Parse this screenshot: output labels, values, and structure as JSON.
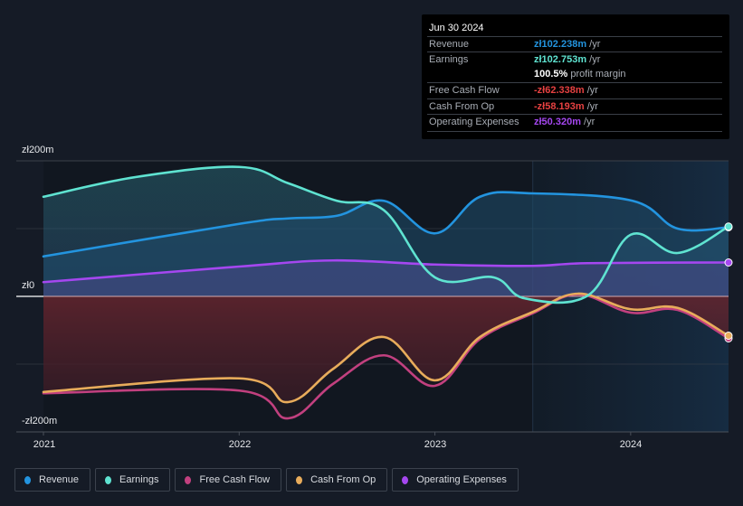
{
  "tooltip": {
    "date": "Jun 30 2024",
    "rows": [
      {
        "label": "Revenue",
        "value": "zł102.238m",
        "unit": " /yr",
        "color": "#2394df"
      },
      {
        "label": "Earnings",
        "value": "zł102.753m",
        "unit": " /yr",
        "color": "#5fe3d1"
      },
      {
        "label": "",
        "value": "100.5%",
        "unit": " profit margin",
        "color": "#ffffff"
      },
      {
        "label": "Free Cash Flow",
        "value": "-zł62.338m",
        "unit": " /yr",
        "color": "#e64141"
      },
      {
        "label": "Cash From Op",
        "value": "-zł58.193m",
        "unit": " /yr",
        "color": "#e64141"
      },
      {
        "label": "Operating Expenses",
        "value": "zł50.320m",
        "unit": " /yr",
        "color": "#a547f0"
      }
    ]
  },
  "legend": [
    {
      "label": "Revenue",
      "color": "#2394df"
    },
    {
      "label": "Earnings",
      "color": "#5fe3d1"
    },
    {
      "label": "Free Cash Flow",
      "color": "#c2407f"
    },
    {
      "label": "Cash From Op",
      "color": "#e8ac5b"
    },
    {
      "label": "Operating Expenses",
      "color": "#a547f0"
    }
  ],
  "chart_data": {
    "type": "area",
    "title": "",
    "xlabel": "",
    "ylabel": "",
    "currency": "PLN",
    "ylim": [
      -200,
      200
    ],
    "xlim": [
      2021.0,
      2024.5
    ],
    "y_ticks": [
      {
        "value": 200,
        "label": "zł200m"
      },
      {
        "value": 0,
        "label": "zł0"
      },
      {
        "value": -200,
        "label": "-zł200m"
      }
    ],
    "x_ticks": [
      {
        "value": 2021,
        "label": "2021"
      },
      {
        "value": 2022,
        "label": "2022"
      },
      {
        "value": 2023,
        "label": "2023"
      },
      {
        "value": 2024,
        "label": "2024"
      }
    ],
    "highlight_start": 2023.5,
    "grid": true,
    "legend_position": "bottom-left",
    "series": [
      {
        "name": "Earnings",
        "color": "#5fe3d1",
        "x": [
          2021.0,
          2021.47,
          2022.0,
          2022.25,
          2022.5,
          2022.74,
          2023.0,
          2023.3,
          2023.46,
          2023.78,
          2024.0,
          2024.24,
          2024.5
        ],
        "values": [
          147,
          176,
          191,
          167,
          141,
          127,
          28,
          28,
          -3,
          1,
          91,
          64,
          103
        ]
      },
      {
        "name": "Revenue",
        "color": "#2394df",
        "x": [
          2021.0,
          2022.0,
          2022.25,
          2022.5,
          2022.74,
          2023.0,
          2023.23,
          2023.5,
          2024.01,
          2024.24,
          2024.5
        ],
        "values": [
          59,
          107,
          115,
          119,
          141,
          93,
          147,
          152,
          141,
          100,
          102
        ]
      },
      {
        "name": "Operating Expenses",
        "color": "#a547f0",
        "x": [
          2021.0,
          2022.0,
          2022.48,
          2023.0,
          2023.5,
          2023.78,
          2024.5
        ],
        "values": [
          21,
          44,
          53,
          47,
          45,
          49,
          50
        ]
      },
      {
        "name": "Cash From Op",
        "color": "#e8ac5b",
        "x": [
          2021.0,
          2022.0,
          2022.25,
          2022.48,
          2022.74,
          2023.0,
          2023.23,
          2023.5,
          2023.73,
          2024.0,
          2024.24,
          2024.5
        ],
        "values": [
          -141,
          -121,
          -156,
          -107,
          -60,
          -124,
          -60,
          -23,
          4,
          -19,
          -17,
          -58
        ]
      },
      {
        "name": "Free Cash Flow",
        "color": "#c2407f",
        "x": [
          2021.0,
          2022.0,
          2022.25,
          2022.48,
          2022.74,
          2023.0,
          2023.23,
          2023.5,
          2023.73,
          2024.0,
          2024.24,
          2024.5
        ],
        "values": [
          -143,
          -139,
          -180,
          -129,
          -87,
          -132,
          -63,
          -25,
          3,
          -24,
          -20,
          -62
        ]
      }
    ]
  }
}
